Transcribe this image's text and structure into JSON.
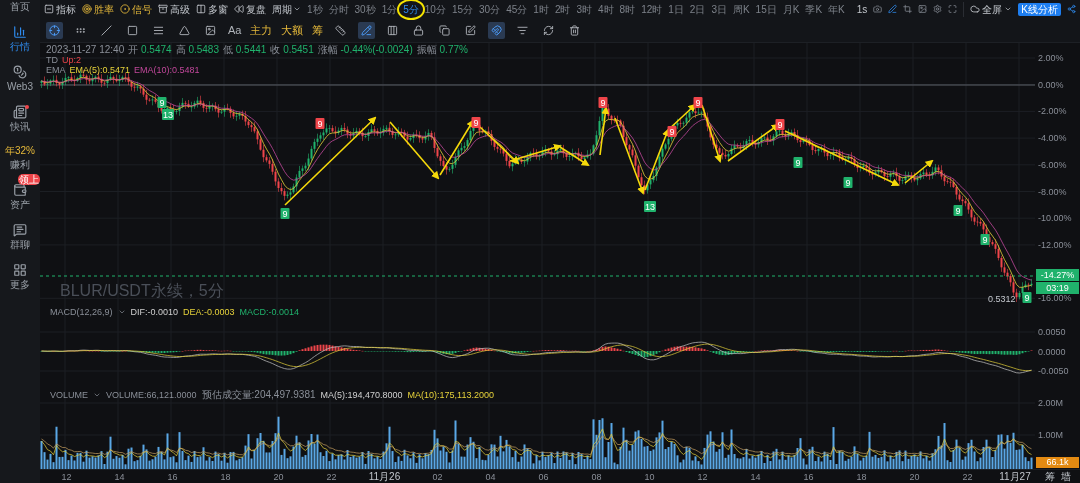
{
  "sidebar": {
    "items": [
      {
        "label": "首页",
        "kind": "home",
        "selected": false,
        "notification_dot": false
      },
      {
        "label": "行情",
        "kind": "market",
        "selected": true,
        "notification_dot": false
      },
      {
        "label": "Web3",
        "kind": "web3",
        "selected": false,
        "notification_dot": false
      },
      {
        "label": "快讯",
        "kind": "news",
        "selected": false,
        "notification_dot": true
      },
      {
        "label": "赚利",
        "kind": "rate",
        "rate": "年32%",
        "selected": false,
        "notification_dot": false
      },
      {
        "label": "资产",
        "kind": "assets",
        "badge": "领上",
        "selected": false,
        "notification_dot": false
      },
      {
        "label": "群聊",
        "kind": "chat",
        "selected": false,
        "notification_dot": false
      },
      {
        "label": "更多",
        "kind": "more",
        "selected": false,
        "notification_dot": false
      }
    ]
  },
  "toolbar": {
    "menu": [
      {
        "label": "指标",
        "highlighted": false
      },
      {
        "label": "胜率",
        "highlighted": true
      },
      {
        "label": "信号",
        "highlighted": true
      },
      {
        "label": "高级",
        "highlighted": false
      },
      {
        "label": "多窗",
        "highlighted": false
      },
      {
        "label": "复盘",
        "highlighted": false
      }
    ],
    "period_label": "周期",
    "periods": [
      {
        "label": "1秒",
        "selected": false
      },
      {
        "label": "分时",
        "selected": false
      },
      {
        "label": "30秒",
        "selected": false
      },
      {
        "label": "1分",
        "selected": false
      },
      {
        "label": "5分",
        "selected": true
      },
      {
        "label": "10分",
        "selected": false
      },
      {
        "label": "15分",
        "selected": false
      },
      {
        "label": "30分",
        "selected": false
      },
      {
        "label": "45分",
        "selected": false
      },
      {
        "label": "1时",
        "selected": false
      },
      {
        "label": "2时",
        "selected": false
      },
      {
        "label": "3时",
        "selected": false
      },
      {
        "label": "4时",
        "selected": false
      },
      {
        "label": "8时",
        "selected": false
      },
      {
        "label": "12时",
        "selected": false
      },
      {
        "label": "1日",
        "selected": false
      },
      {
        "label": "2日",
        "selected": false
      },
      {
        "label": "3日",
        "selected": false
      },
      {
        "label": "周K",
        "selected": false
      },
      {
        "label": "15日",
        "selected": false
      },
      {
        "label": "月K",
        "selected": false
      },
      {
        "label": "季K",
        "selected": false
      },
      {
        "label": "年K",
        "selected": false
      }
    ],
    "refresh_rate": "1s",
    "fullscreen": "全屏",
    "analysis_button": "K线分析"
  },
  "drawing_tools": [
    {
      "kind": "icon",
      "selected": true
    },
    {
      "kind": "icon",
      "selected": false
    },
    {
      "kind": "icon",
      "selected": false
    },
    {
      "kind": "icon",
      "selected": false
    },
    {
      "kind": "icon",
      "selected": false
    },
    {
      "kind": "icon",
      "selected": false
    },
    {
      "kind": "icon",
      "selected": false
    },
    {
      "kind": "text",
      "label": "Aa"
    },
    {
      "kind": "accent",
      "label": "主力"
    },
    {
      "kind": "accent",
      "label": "大额"
    },
    {
      "kind": "accent",
      "label": "筹"
    },
    {
      "kind": "icon",
      "selected": false
    },
    {
      "kind": "icon",
      "selected": true
    },
    {
      "kind": "icon",
      "selected": false
    },
    {
      "kind": "icon",
      "selected": false
    },
    {
      "kind": "icon",
      "selected": false
    },
    {
      "kind": "icon",
      "selected": false
    },
    {
      "kind": "icon",
      "selected": true
    },
    {
      "kind": "icon",
      "selected": false
    },
    {
      "kind": "icon",
      "selected": false
    },
    {
      "kind": "icon",
      "selected": false
    }
  ],
  "main_chart": {
    "datetime": "2023-11-27 12:40",
    "ohlc": [
      {
        "label": "开",
        "value": "0.5474"
      },
      {
        "label": "高",
        "value": "0.5483"
      },
      {
        "label": "低",
        "value": "0.5441"
      },
      {
        "label": "收",
        "value": "0.5451"
      },
      {
        "label": "涨幅",
        "value": "-0.44%(-0.0024)"
      },
      {
        "label": "振幅",
        "value": "0.77%"
      }
    ],
    "td": {
      "name": "TD",
      "value": "Up:2"
    },
    "ema": {
      "name": "EMA",
      "ema5": "EMA(5):0.5471",
      "ema10": "EMA(10):0.5481"
    },
    "watermark": "BLUR/USDT永续，5分",
    "td_markers": [
      {
        "label": "9",
        "kind": "buy"
      },
      {
        "label": "13",
        "kind": "buy"
      },
      {
        "label": "9",
        "kind": "buy"
      },
      {
        "label": "9",
        "kind": "sell"
      },
      {
        "label": "9",
        "kind": "sell"
      },
      {
        "label": "9",
        "kind": "sell"
      },
      {
        "label": "13",
        "kind": "buy"
      },
      {
        "label": "9",
        "kind": "sell"
      },
      {
        "label": "9",
        "kind": "sell"
      },
      {
        "label": "9",
        "kind": "sell"
      },
      {
        "label": "9",
        "kind": "buy"
      },
      {
        "label": "9",
        "kind": "buy"
      },
      {
        "label": "9",
        "kind": "buy"
      },
      {
        "label": "9",
        "kind": "buy"
      },
      {
        "label": "9",
        "kind": "buy"
      }
    ],
    "low_label": "0.5312",
    "y_ticks": [
      "2.00%",
      "0.00%",
      "-2.00%",
      "-4.00%",
      "-6.00%",
      "-8.00%",
      "-10.00%",
      "-12.00%",
      "-16.00%"
    ],
    "price_tag": "-14.27%",
    "countdown": "03:19"
  },
  "macd": {
    "name": "MACD(12,26,9)",
    "dif": "DIF:-0.0010",
    "dea": "DEA:-0.0003",
    "macd": "MACD:-0.0014",
    "y_ticks": [
      "0.0050",
      "0.0000",
      "-0.0050"
    ]
  },
  "volume": {
    "name": "VOLUME",
    "volume": "VOLUME:66,121.0000",
    "estimate": "预估成交量:204,497.9381",
    "ma5": "MA(5):194,470.8000",
    "ma10": "MA(10):175,113.2000",
    "y_ticks": [
      "2.00M",
      "1.00M"
    ],
    "current_tag": "66.1k"
  },
  "x_axis": {
    "labels": [
      "12",
      "14",
      "16",
      "18",
      "20",
      "22",
      "11月26",
      "02",
      "04",
      "06",
      "08",
      "10",
      "12",
      "14",
      "16",
      "18",
      "20",
      "22",
      "11月27"
    ],
    "buttons": [
      "筹",
      "墙"
    ]
  }
}
